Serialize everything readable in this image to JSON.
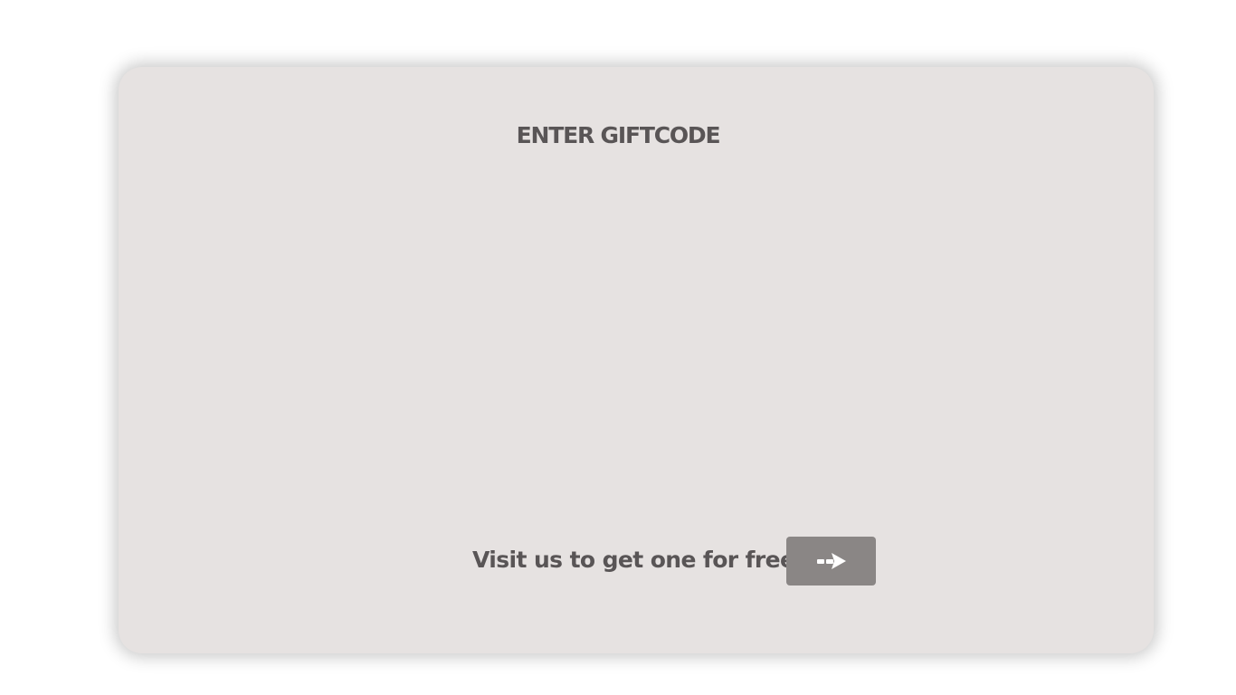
{
  "giftcode": {
    "title": "ENTER GIFTCODE",
    "visit_text": "Visit us to get one for free",
    "go_button_icon": "arrow-right-icon",
    "colors": {
      "card_background": "#e6e2e1",
      "text": "#595556",
      "button_background": "#8a8685",
      "button_icon": "#ffffff"
    }
  }
}
